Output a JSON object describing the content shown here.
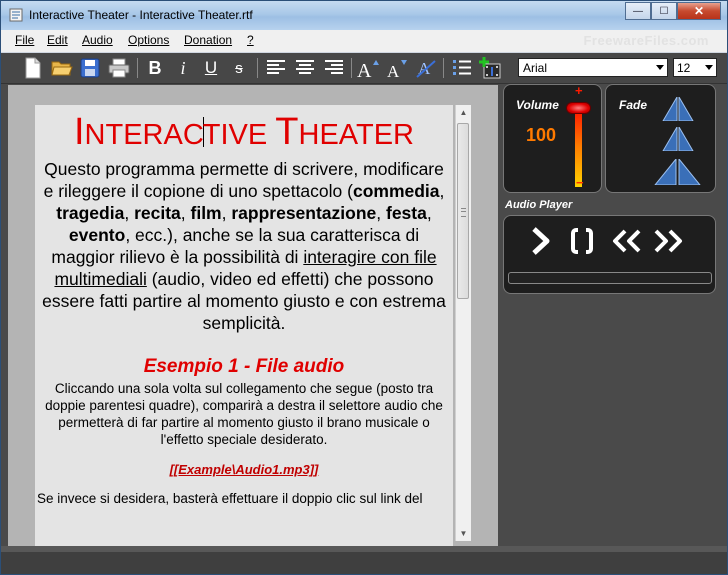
{
  "window": {
    "title": "Interactive Theater - Interactive Theater.rtf",
    "controls": {
      "minimize": "—",
      "maximize": "☐",
      "close": "✕"
    }
  },
  "menu": {
    "items": [
      "File",
      "Edit",
      "Audio",
      "Options",
      "Donation",
      "?"
    ],
    "watermark": "FreewareFiles.com"
  },
  "toolbar": {
    "bold": "B",
    "italic": "i",
    "underline": "U",
    "strike": "s",
    "font_family": "Arial",
    "font_size": "12"
  },
  "document": {
    "title_part1_big": "I",
    "title_part1_rest": "NTERAC",
    "title_part2": "TIVE ",
    "title_part3_big": "T",
    "title_part3_rest": "HEATER",
    "intro_html_segments": {
      "s1": "Questo programma permette di scrivere, modificare e rileggere il copione di uno spettacolo (",
      "b1": "commedia",
      "s2": ", ",
      "b2": "tragedia",
      "s3": ", ",
      "b3": "recita",
      "s4": ", ",
      "b4": "film",
      "s5": ", ",
      "b5": "rappresentazione",
      "s6": ", ",
      "b6": "festa",
      "s7": ", ",
      "b7": "evento",
      "s8": ", ecc.), anche se la sua caratterisca di maggior rilievo è la possibilità di ",
      "u1": "interagire con file multimediali",
      "s9": " (audio, video ed effetti) che possono essere fatti partire al momento giusto e con estrema semplicità."
    },
    "example_title": "Esempio 1 - File audio",
    "example_body": "Cliccando una sola volta sul collegamento che segue (posto tra doppie parentesi quadre), comparirà a destra il selettore audio che permetterà di far partire al momento giusto il brano musicale o l'effetto speciale desiderato.",
    "link_text": "[[Example\\Audio1.mp3]]",
    "last_line": "Se invece si desidera, basterà effettuare il doppio clic sul link del"
  },
  "volume": {
    "label": "Volume",
    "value": "100",
    "plus": "+",
    "minus": "−",
    "level": 1.0
  },
  "fade": {
    "label": "Fade"
  },
  "audio_player": {
    "label": "Audio Player"
  },
  "colors": {
    "accent_red": "#e00000",
    "volume_orange": "#ff7a00",
    "panel_bg": "#1e1e1e"
  }
}
